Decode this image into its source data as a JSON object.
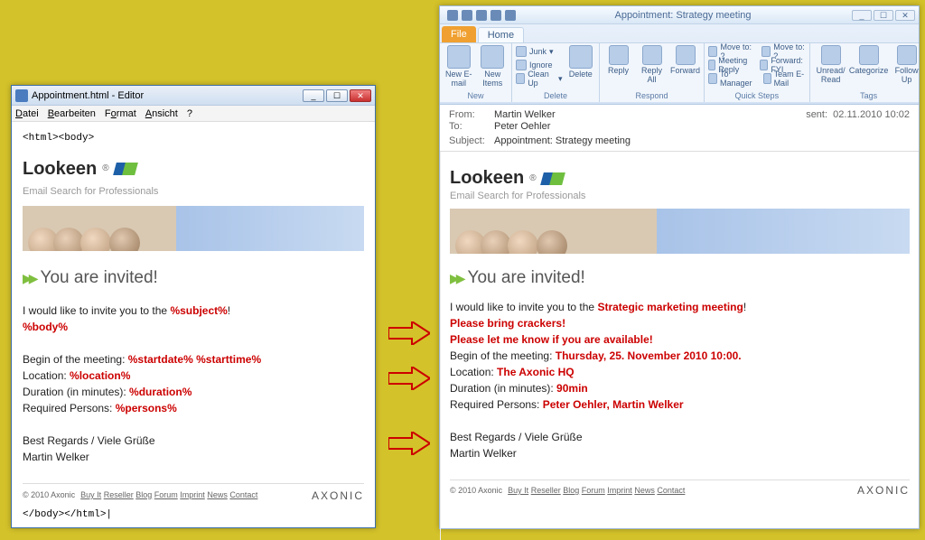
{
  "left": {
    "title": "Appointment.html - Editor",
    "menus": {
      "file": "Datei",
      "edit": "Bearbeiten",
      "format": "Format",
      "view": "Ansicht",
      "help": "?"
    },
    "open_tag": "<html><body>",
    "close_tag": "</body></html>|",
    "brand": {
      "name": "Lookeen",
      "reg": "®",
      "tagline": "Email Search for Professionals"
    },
    "heading": "You are invited!",
    "t": {
      "invite_pre": "I would like to invite you to the ",
      "subject_ph": "%subject%",
      "bang": "!",
      "body_ph": "%body%",
      "begin_pre": "Begin of the meeting: ",
      "begin_ph": "%startdate% %starttime%",
      "loc_pre": "Location: ",
      "loc_ph": "%location%",
      "dur_pre": "Duration (in minutes): ",
      "dur_ph": "%duration%",
      "req_pre": "Required Persons: ",
      "req_ph": "%persons%",
      "regards": "Best Regards / Viele Grüße",
      "signer": "Martin Welker"
    },
    "footer": {
      "copy": "© 2010 Axonic",
      "links": [
        "Buy It",
        "Reseller",
        "Blog",
        "Forum",
        "Imprint",
        "News",
        "Contact"
      ],
      "ax": "AXONIC"
    }
  },
  "right": {
    "title": "Appointment: Strategy meeting",
    "tabs": {
      "file": "File",
      "home": "Home"
    },
    "ribbon": {
      "new": {
        "label": "New",
        "newemail": "New E-mail",
        "newitems": "New Items"
      },
      "delete": {
        "label": "Delete",
        "junk": "Junk",
        "ignore": "Ignore",
        "cleanup": "Clean Up",
        "delete": "Delete"
      },
      "respond": {
        "label": "Respond",
        "reply": "Reply",
        "replyall": "Reply All",
        "forward": "Forward"
      },
      "quick": {
        "label": "Quick Steps",
        "moveto": "Move to: ?",
        "meeting": "Meeting Reply",
        "manager": "To Manager",
        "fwdfyi": "Forward: FYI",
        "team": "Team E-Mail"
      },
      "tags": {
        "label": "Tags",
        "unread": "Unread/ Read",
        "categorize": "Categorize",
        "followup": "Follow Up"
      }
    },
    "hdr": {
      "from_k": "From:",
      "from": "Martin Welker",
      "to_k": "To:",
      "to": "Peter Oehler",
      "subj_k": "Subject:",
      "subj": "Appointment: Strategy meeting",
      "sent_k": "sent:",
      "sent": "02.11.2010 10:02"
    },
    "brand": {
      "name": "Lookeen",
      "reg": "®",
      "tagline": "Email Search for Professionals"
    },
    "heading": "You are invited!",
    "t": {
      "invite_pre": "I would like to invite you to the ",
      "subject": "Strategic marketing meeting",
      "bang": "!",
      "body1": "Please bring crackers!",
      "body2": "Please let me know if you are available!",
      "begin_pre": "Begin of the meeting: ",
      "begin": "Thursday, 25. November 2010 10:00.",
      "loc_pre": "Location: ",
      "loc": "The Axonic HQ",
      "dur_pre": "Duration (in minutes): ",
      "dur": "90min",
      "req_pre": "Required Persons: ",
      "req": "Peter Oehler, Martin Welker",
      "regards": "Best Regards / Viele Grüße",
      "signer": "Martin Welker"
    },
    "footer": {
      "copy": "© 2010 Axonic",
      "links": [
        "Buy It",
        "Reseller",
        "Blog",
        "Forum",
        "Imprint",
        "News",
        "Contact"
      ],
      "ax": "AXONIC"
    }
  }
}
